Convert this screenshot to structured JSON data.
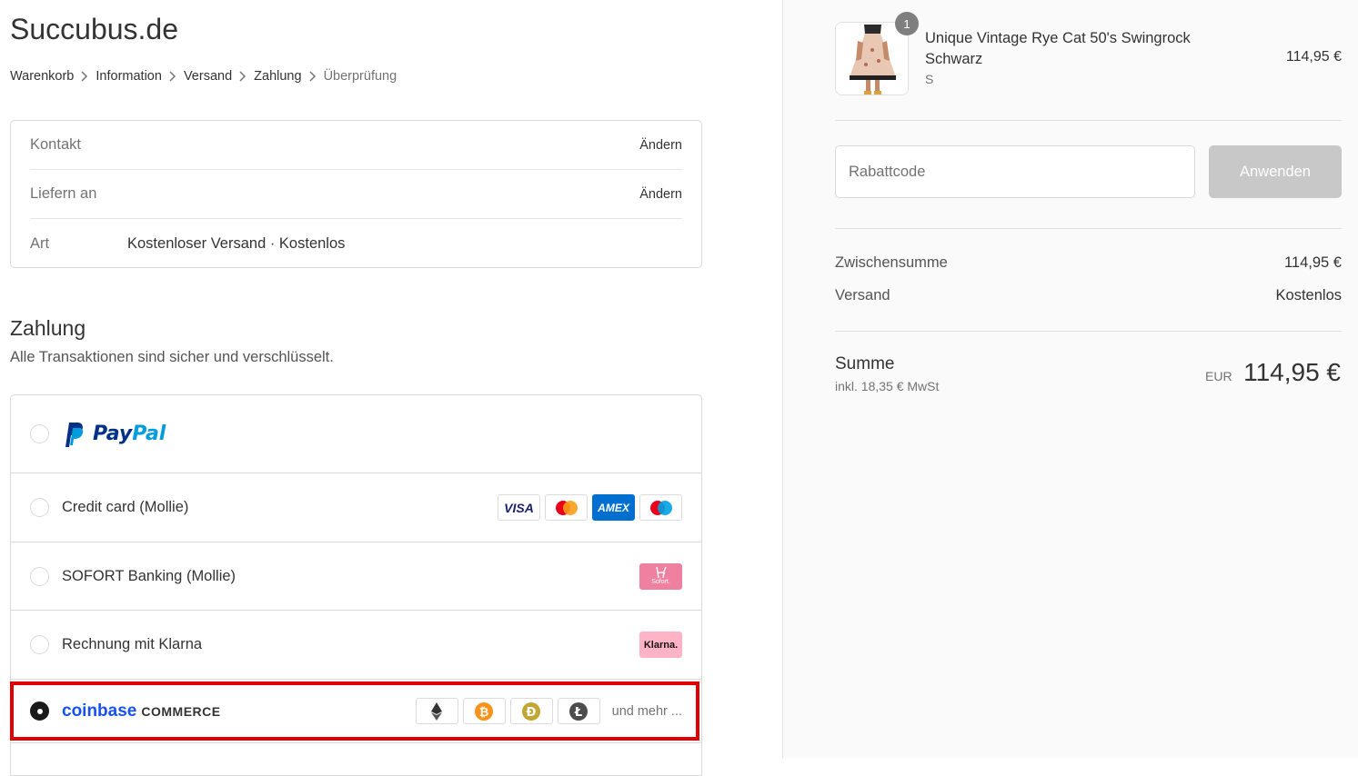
{
  "shop": {
    "title": "Succubus.de"
  },
  "breadcrumb": [
    {
      "label": "Warenkorb"
    },
    {
      "label": "Information"
    },
    {
      "label": "Versand"
    },
    {
      "label": "Zahlung"
    },
    {
      "label": "Überprüfung"
    }
  ],
  "review": {
    "contact_label": "Kontakt",
    "contact_change": "Ändern",
    "ship_label": "Liefern an",
    "ship_change": "Ändern",
    "method_label": "Art",
    "method_value": "Kostenloser Versand · Kostenlos"
  },
  "payment": {
    "title": "Zahlung",
    "subtitle": "Alle Transaktionen sind sicher und verschlüsselt.",
    "paypal_pay": "Pay",
    "paypal_pal": "Pal",
    "credit_card": "Credit card (Mollie)",
    "sofort": "SOFORT Banking (Mollie)",
    "sofort_badge": "Sofort.",
    "klarna": "Rechnung mit Klarna",
    "klarna_badge": "Klarna.",
    "visa": "VISA",
    "amex": "AMEX",
    "coinbase_word": "coinbase",
    "coinbase_commerce": "COMMERCE",
    "more": "und mehr ...",
    "selected": "coinbase"
  },
  "colors": {
    "accent_red": "#e00000",
    "paypal_dark": "#003087",
    "paypal_light": "#009cde",
    "coinbase_blue": "#1652f0"
  },
  "order": {
    "product_name": "Unique Vintage Rye Cat 50's Swingrock Schwarz",
    "variant": "S",
    "quantity": "1",
    "price": "114,95 €",
    "discount_placeholder": "Rabattcode",
    "apply_label": "Anwenden",
    "subtotal_label": "Zwischensumme",
    "subtotal_value": "114,95 €",
    "shipping_label": "Versand",
    "shipping_value": "Kostenlos",
    "total_label": "Summe",
    "tax_note": "inkl. 18,35 € MwSt",
    "currency": "EUR",
    "total": "114,95 €"
  }
}
